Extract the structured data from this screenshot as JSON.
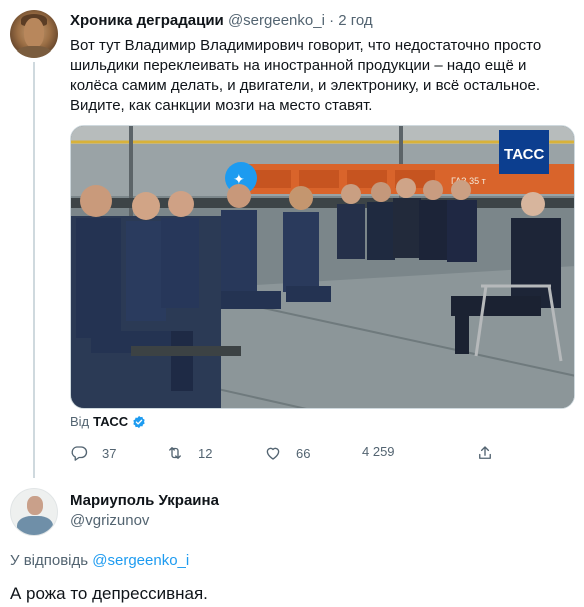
{
  "tweet": {
    "author_name": "Хроника деградации",
    "handle": "@sergeenko_i",
    "separator": "·",
    "time": "2 год",
    "text": "Вот тут Владимир Владимирович говорит, что недостаточно просто шильдики переклеивать на иностранной продукции – надо ещё и колёса самим делать, и двигатели, и электронику, и всё остальное. Видите, как санкции мозги на место ставят.",
    "media": {
      "watermark": "ТАСС",
      "wagon_text": "ГАЗ 35 т"
    },
    "via_prefix": "Від",
    "via_source": "ТАСС",
    "actions": {
      "replies": "37",
      "retweets": "12",
      "likes": "66",
      "views": "4 259"
    },
    "colors": {
      "accent": "#1d9bf0",
      "muted": "#536471"
    }
  },
  "reply": {
    "author_name": "Мариуполь Украина",
    "handle": "@vgrizunov",
    "reply_prefix": "У відповідь",
    "reply_to": "@sergeenko_i",
    "text": "А рожа то депрессивная."
  }
}
